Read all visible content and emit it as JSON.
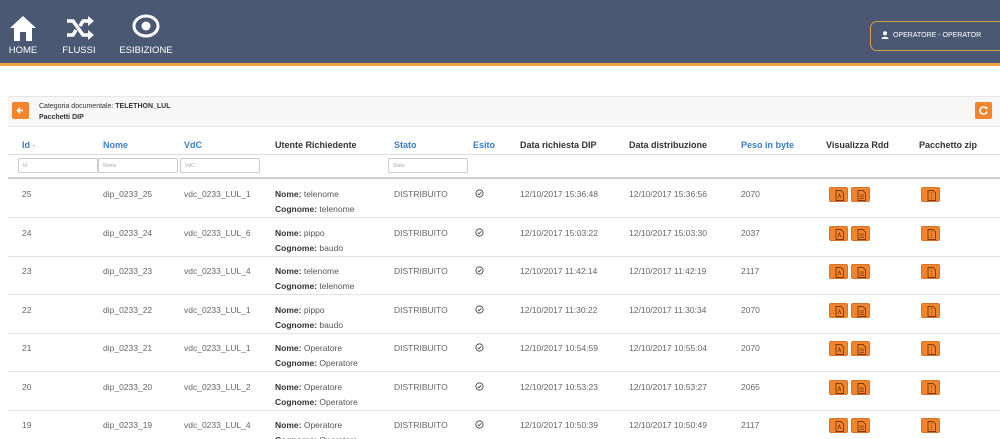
{
  "nav": {
    "home_label": "HOME",
    "flussi_label": "FLUSSI",
    "esibizione_label": "ESIBIZIONE",
    "user_menu_label": "OPERATORE  -  OPERATOR"
  },
  "breadcrumb": {
    "category_prefix": "Categoria documentale:",
    "category_value": "TELETHON_LUL",
    "subtitle": "Pacchetti DIP"
  },
  "colors": {
    "topbar": "#4a5873",
    "accent": "#f0852e",
    "link": "#3a7dc9"
  },
  "table": {
    "headers": {
      "id": "Id",
      "nome": "Nome",
      "vdc": "VdC",
      "utente": "Utente Richiedente",
      "stato": "Stato",
      "esito": "Esito",
      "data_richiesta": "Data richiesta DIP",
      "data_distribuzione": "Data distribuzione",
      "peso": "Peso in byte",
      "visualizza": "Visualizza Rdd",
      "pacchetto": "Pacchetto zip"
    },
    "filters": {
      "id_placeholder": "Id",
      "nome_placeholder": "Nome",
      "vdc_placeholder": "VdC",
      "stato_placeholder": "Stato"
    },
    "nome_label": "Nome:",
    "cognome_label": "Cognome:",
    "rows": [
      {
        "id": "25",
        "nome": "dip_0233_25",
        "vdc": "vdc_0233_LUL_1",
        "user_nome": "telenome",
        "user_cognome": "telenome",
        "stato": "DISTRIBUITO",
        "data_richiesta": "12/10/2017 15:36:48",
        "data_distribuzione": "12/10/2017 15:36:56",
        "peso": "2070"
      },
      {
        "id": "24",
        "nome": "dip_0233_24",
        "vdc": "vdc_0233_LUL_6",
        "user_nome": "pippo",
        "user_cognome": "baudo",
        "stato": "DISTRIBUITO",
        "data_richiesta": "12/10/2017 15:03:22",
        "data_distribuzione": "12/10/2017 15:03:30",
        "peso": "2037"
      },
      {
        "id": "23",
        "nome": "dip_0233_23",
        "vdc": "vdc_0233_LUL_4",
        "user_nome": "telenome",
        "user_cognome": "telenome",
        "stato": "DISTRIBUITO",
        "data_richiesta": "12/10/2017 11:42:14",
        "data_distribuzione": "12/10/2017 11:42:19",
        "peso": "2117"
      },
      {
        "id": "22",
        "nome": "dip_0233_22",
        "vdc": "vdc_0233_LUL_1",
        "user_nome": "pippo",
        "user_cognome": "baudo",
        "stato": "DISTRIBUITO",
        "data_richiesta": "12/10/2017 11:30:22",
        "data_distribuzione": "12/10/2017 11:30:34",
        "peso": "2070"
      },
      {
        "id": "21",
        "nome": "dip_0233_21",
        "vdc": "vdc_0233_LUL_1",
        "user_nome": "Operatore",
        "user_cognome": "Operatore",
        "stato": "DISTRIBUITO",
        "data_richiesta": "12/10/2017 10:54:59",
        "data_distribuzione": "12/10/2017 10:55:04",
        "peso": "2070"
      },
      {
        "id": "20",
        "nome": "dip_0233_20",
        "vdc": "vdc_0233_LUL_2",
        "user_nome": "Operatore",
        "user_cognome": "Operatore",
        "stato": "DISTRIBUITO",
        "data_richiesta": "12/10/2017 10:53:23",
        "data_distribuzione": "12/10/2017 10:53:27",
        "peso": "2065"
      },
      {
        "id": "19",
        "nome": "dip_0233_19",
        "vdc": "vdc_0233_LUL_4",
        "user_nome": "Operatore",
        "user_cognome": "Operatore",
        "stato": "DISTRIBUITO",
        "data_richiesta": "12/10/2017 10:50:39",
        "data_distribuzione": "12/10/2017 10:50:49",
        "peso": "2117"
      }
    ]
  }
}
